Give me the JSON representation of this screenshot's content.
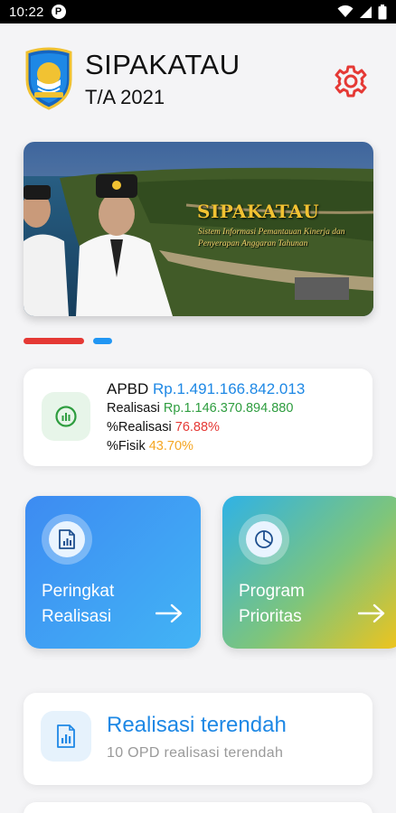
{
  "status_bar": {
    "time": "10:22",
    "app_badge": "P"
  },
  "header": {
    "title": "SIPAKATAU",
    "subtitle": "T/A 2021",
    "logo_icon": "regency-emblem-icon",
    "settings_icon": "gear-icon"
  },
  "banner": {
    "title": "SIPAKATAU",
    "tagline": "Sistem Informasi Pemantauan Kinerja dan Penyerapan Anggaran Tahunan"
  },
  "carousel": {
    "active_index": 0,
    "count": 2
  },
  "summary": {
    "apbd_label": "APBD",
    "apbd_value": "Rp.1.491.166.842.013",
    "realisasi_label": "Realisasi",
    "realisasi_value": "Rp.1.146.370.894.880",
    "pct_realisasi_label": "%Realisasi",
    "pct_realisasi_value": "76.88%",
    "pct_fisik_label": "%Fisik",
    "pct_fisik_value": "43.70%"
  },
  "menu": {
    "tiles": [
      {
        "label": "Peringkat\nRealisasi",
        "icon": "document-chart-icon"
      },
      {
        "label": "Program\nPrioritas",
        "icon": "pie-chart-icon"
      }
    ]
  },
  "lowest": {
    "title": "Realisasi terendah",
    "subtitle": "10 OPD realisasi terendah",
    "icon": "document-chart-icon"
  },
  "colors": {
    "blue": "#1e88e5",
    "green": "#2e9d3f",
    "red": "#e53935",
    "orange": "#f5a623"
  }
}
